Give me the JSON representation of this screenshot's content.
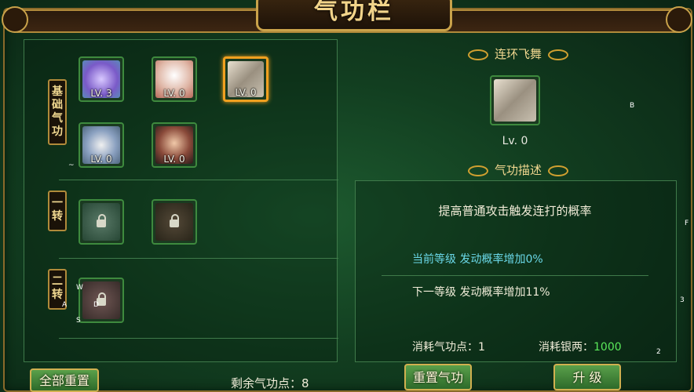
{
  "window": {
    "title": "气功栏"
  },
  "rows": [
    {
      "label": "基础气功",
      "skills": [
        {
          "lv": "LV. 3",
          "color": "#9a7ad8"
        },
        {
          "lv": "LV. 0",
          "color": "#d8b8a8"
        },
        {
          "lv": "LV. 0",
          "color": "#b8b0a0",
          "selected": true
        }
      ]
    },
    {
      "label": "",
      "skills": [
        {
          "lv": "LV. 0",
          "color": "#b8c8d8"
        },
        {
          "lv": "LV. 0",
          "color": "#d89878"
        }
      ]
    },
    {
      "label": "一转",
      "skills": [
        {
          "locked": true
        },
        {
          "locked": true
        }
      ]
    },
    {
      "label": "二转",
      "skills": [
        {
          "locked": true
        }
      ]
    }
  ],
  "left_footer": {
    "reset_all": "全部重置",
    "remaining_points": "剩余气功点：8"
  },
  "detail": {
    "skill_name": "连环飞舞",
    "skill_level": "Lv. 0",
    "desc_heading": "气功描述",
    "description": "提高普通攻击触发连打的概率",
    "current_level": "当前等级  发动概率增加0%",
    "next_level": "下一等级  发动概率增加11%",
    "cost_points": "消耗气功点：1",
    "cost_silver_label": "消耗银两：",
    "cost_silver_value": "1000",
    "reset_button": "重置气功",
    "upgrade_button": "升 级"
  },
  "debug_labels": {
    "b": "B",
    "w": "W",
    "a": "A",
    "s": "S",
    "d": "D",
    "f": "F",
    "three": "3",
    "two": "2",
    "tilde": "~"
  }
}
